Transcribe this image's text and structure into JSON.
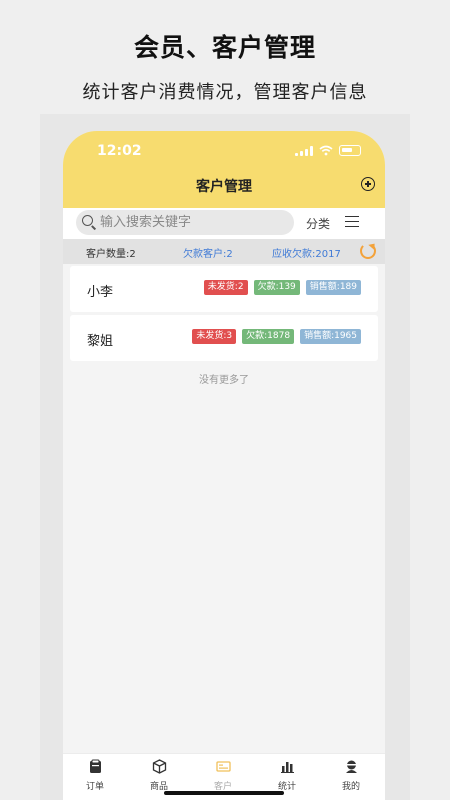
{
  "promo": {
    "title": "会员、客户管理",
    "subtitle": "统计客户消费情况，管理客户信息"
  },
  "status_bar": {
    "time": "12:02"
  },
  "nav": {
    "title": "客户管理",
    "add_icon": "plus-circle-icon"
  },
  "search": {
    "placeholder": "输入搜索关键字",
    "value": "",
    "category_label": "分类",
    "icon": "search-icon"
  },
  "summary": {
    "customer_count": "客户数量:2",
    "debt_customers": "欠款客户:2",
    "receivable": "应收欠款:2017",
    "refresh_icon": "refresh-icon"
  },
  "customers": [
    {
      "name": "小李",
      "unshipped": "未发货:2",
      "debt": "欠款:139",
      "sales": "销售额:189"
    },
    {
      "name": "黎姐",
      "unshipped": "未发货:3",
      "debt": "欠款:1878",
      "sales": "销售额:1965"
    }
  ],
  "footer_note": "没有更多了",
  "tabs": [
    {
      "label": "订单",
      "icon": "order-icon"
    },
    {
      "label": "商品",
      "icon": "box-icon"
    },
    {
      "label": "客户",
      "icon": "customer-card-icon"
    },
    {
      "label": "统计",
      "icon": "bar-chart-icon"
    },
    {
      "label": "我的",
      "icon": "profile-icon"
    }
  ],
  "colors": {
    "header": "#f7dc6f",
    "accent_blue": "#3f7ad6",
    "refresh": "#f3a23a",
    "tag_red": "#e14f4f",
    "tag_green": "#74b879",
    "tag_blue": "#8fb6d6"
  }
}
